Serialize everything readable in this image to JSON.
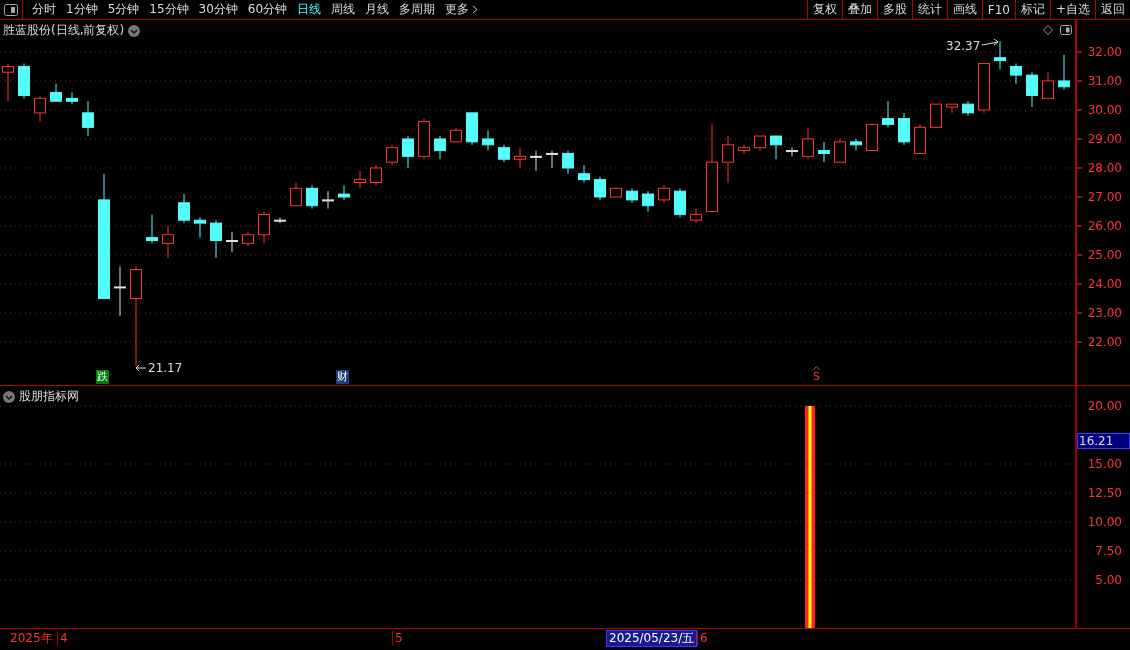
{
  "toolbar": {
    "periods": [
      {
        "label": "分时",
        "selected": false
      },
      {
        "label": "1分钟",
        "selected": false
      },
      {
        "label": "5分钟",
        "selected": false
      },
      {
        "label": "15分钟",
        "selected": false
      },
      {
        "label": "30分钟",
        "selected": false
      },
      {
        "label": "60分钟",
        "selected": false
      },
      {
        "label": "日线",
        "selected": true
      },
      {
        "label": "周线",
        "selected": false
      },
      {
        "label": "月线",
        "selected": false
      },
      {
        "label": "多周期",
        "selected": false
      },
      {
        "label": "更多",
        "selected": false
      }
    ],
    "buttons": [
      "复权",
      "叠加",
      "多股",
      "统计",
      "画线",
      "F10",
      "标记",
      "+自选",
      "返回"
    ]
  },
  "main_chart": {
    "title": "胜蓝股份(日线,前复权)",
    "high_label": "32.37",
    "low_label": "21.17",
    "chart_data": {
      "type": "candlestick",
      "grid": true,
      "ylim": [
        20.52,
        33.1
      ],
      "yticks": [
        {
          "value": 32,
          "label": "32.00"
        },
        {
          "value": 31,
          "label": "31.00"
        },
        {
          "value": 30,
          "label": "30.00"
        },
        {
          "value": 29,
          "label": "29.00"
        },
        {
          "value": 28,
          "label": "28.00"
        },
        {
          "value": 27,
          "label": "27.00"
        },
        {
          "value": 26,
          "label": "26.00"
        },
        {
          "value": 25,
          "label": "25.00"
        },
        {
          "value": 24,
          "label": "24.00"
        },
        {
          "value": 23,
          "label": "23.00"
        },
        {
          "value": 22,
          "label": "22.00"
        }
      ],
      "ohlc": [
        [
          31.3,
          31.6,
          30.3,
          31.5
        ],
        [
          31.5,
          31.6,
          30.4,
          30.5
        ],
        [
          29.9,
          30.5,
          29.6,
          30.4
        ],
        [
          30.6,
          30.9,
          30.3,
          30.3
        ],
        [
          30.4,
          30.6,
          30.2,
          30.3
        ],
        [
          29.9,
          30.3,
          29.1,
          29.4
        ],
        [
          26.9,
          27.8,
          23.5,
          23.5
        ],
        [
          23.9,
          24.6,
          22.9,
          23.9
        ],
        [
          23.5,
          24.6,
          21.17,
          24.5
        ],
        [
          25.6,
          26.4,
          25.4,
          25.5
        ],
        [
          25.4,
          26.0,
          24.9,
          25.7
        ],
        [
          26.8,
          27.1,
          26.1,
          26.2
        ],
        [
          26.2,
          26.3,
          25.6,
          26.1
        ],
        [
          26.1,
          26.2,
          24.9,
          25.5
        ],
        [
          25.5,
          25.8,
          25.1,
          25.5
        ],
        [
          25.4,
          25.8,
          25.3,
          25.7
        ],
        [
          25.7,
          26.5,
          25.4,
          26.4
        ],
        [
          26.2,
          26.3,
          26.1,
          26.2
        ],
        [
          26.7,
          27.5,
          26.7,
          27.3
        ],
        [
          27.3,
          27.4,
          26.6,
          26.7
        ],
        [
          26.9,
          27.2,
          26.6,
          26.9
        ],
        [
          27.1,
          27.4,
          26.9,
          27.0
        ],
        [
          27.5,
          27.9,
          27.3,
          27.6
        ],
        [
          27.5,
          28.1,
          27.4,
          28.0
        ],
        [
          28.2,
          28.8,
          28.1,
          28.7
        ],
        [
          29.0,
          29.1,
          28.0,
          28.4
        ],
        [
          28.4,
          29.7,
          28.3,
          29.6
        ],
        [
          29.0,
          29.1,
          28.3,
          28.6
        ],
        [
          28.9,
          29.4,
          28.9,
          29.3
        ],
        [
          29.9,
          29.9,
          28.8,
          28.9
        ],
        [
          29.0,
          29.3,
          28.6,
          28.8
        ],
        [
          28.7,
          28.8,
          28.2,
          28.3
        ],
        [
          28.3,
          28.7,
          28.0,
          28.4
        ],
        [
          28.4,
          28.6,
          27.9,
          28.4
        ],
        [
          28.5,
          28.6,
          28.0,
          28.5
        ],
        [
          28.5,
          28.6,
          27.8,
          28.0
        ],
        [
          27.8,
          28.1,
          27.5,
          27.6
        ],
        [
          27.6,
          27.7,
          26.9,
          27.0
        ],
        [
          27.0,
          27.3,
          27.0,
          27.3
        ],
        [
          27.2,
          27.3,
          26.8,
          26.9
        ],
        [
          27.1,
          27.2,
          26.5,
          26.7
        ],
        [
          26.9,
          27.4,
          26.8,
          27.3
        ],
        [
          27.2,
          27.3,
          26.3,
          26.4
        ],
        [
          26.2,
          26.6,
          26.1,
          26.4
        ],
        [
          26.5,
          29.5,
          26.5,
          28.2
        ],
        [
          28.2,
          29.1,
          27.5,
          28.8
        ],
        [
          28.6,
          28.8,
          28.5,
          28.7
        ],
        [
          28.7,
          29.1,
          28.6,
          29.1
        ],
        [
          29.1,
          29.1,
          28.3,
          28.8
        ],
        [
          28.6,
          28.7,
          28.4,
          28.6
        ],
        [
          28.4,
          29.4,
          28.3,
          29.0
        ],
        [
          28.6,
          28.9,
          28.2,
          28.5
        ],
        [
          28.2,
          29.0,
          28.2,
          28.9
        ],
        [
          28.9,
          29.0,
          28.6,
          28.8
        ],
        [
          28.6,
          29.5,
          28.6,
          29.5
        ],
        [
          29.7,
          30.3,
          29.4,
          29.5
        ],
        [
          29.7,
          29.9,
          28.8,
          28.9
        ],
        [
          28.5,
          29.5,
          28.5,
          29.4
        ],
        [
          29.4,
          30.2,
          29.4,
          30.2
        ],
        [
          30.1,
          30.2,
          29.9,
          30.2
        ],
        [
          30.2,
          30.3,
          29.8,
          29.9
        ],
        [
          30.0,
          31.6,
          29.9,
          31.6
        ],
        [
          31.8,
          32.37,
          31.4,
          31.7
        ],
        [
          31.5,
          31.6,
          30.9,
          31.2
        ],
        [
          31.2,
          31.3,
          30.1,
          30.5
        ],
        [
          30.4,
          31.3,
          30.4,
          31.0
        ],
        [
          31.0,
          31.9,
          30.7,
          30.8
        ]
      ]
    },
    "markers": [
      {
        "label": "跌",
        "kind": "fall"
      },
      {
        "label": "财",
        "kind": "finance"
      },
      {
        "label": "S",
        "kind": "sell"
      }
    ]
  },
  "indicator": {
    "title": "股朋指标网",
    "y_ticks": [
      "20.00",
      "15.00",
      "12.50",
      "10.00",
      "7.50",
      "5.00"
    ],
    "current_value": "16.21"
  },
  "time_axis": [
    {
      "text": "2025年",
      "kind": "year"
    },
    {
      "text": "4",
      "kind": "month"
    },
    {
      "text": "5",
      "kind": "month"
    },
    {
      "text": "2025/05/23/五",
      "kind": "cursor"
    },
    {
      "text": "6",
      "kind": "month"
    }
  ]
}
